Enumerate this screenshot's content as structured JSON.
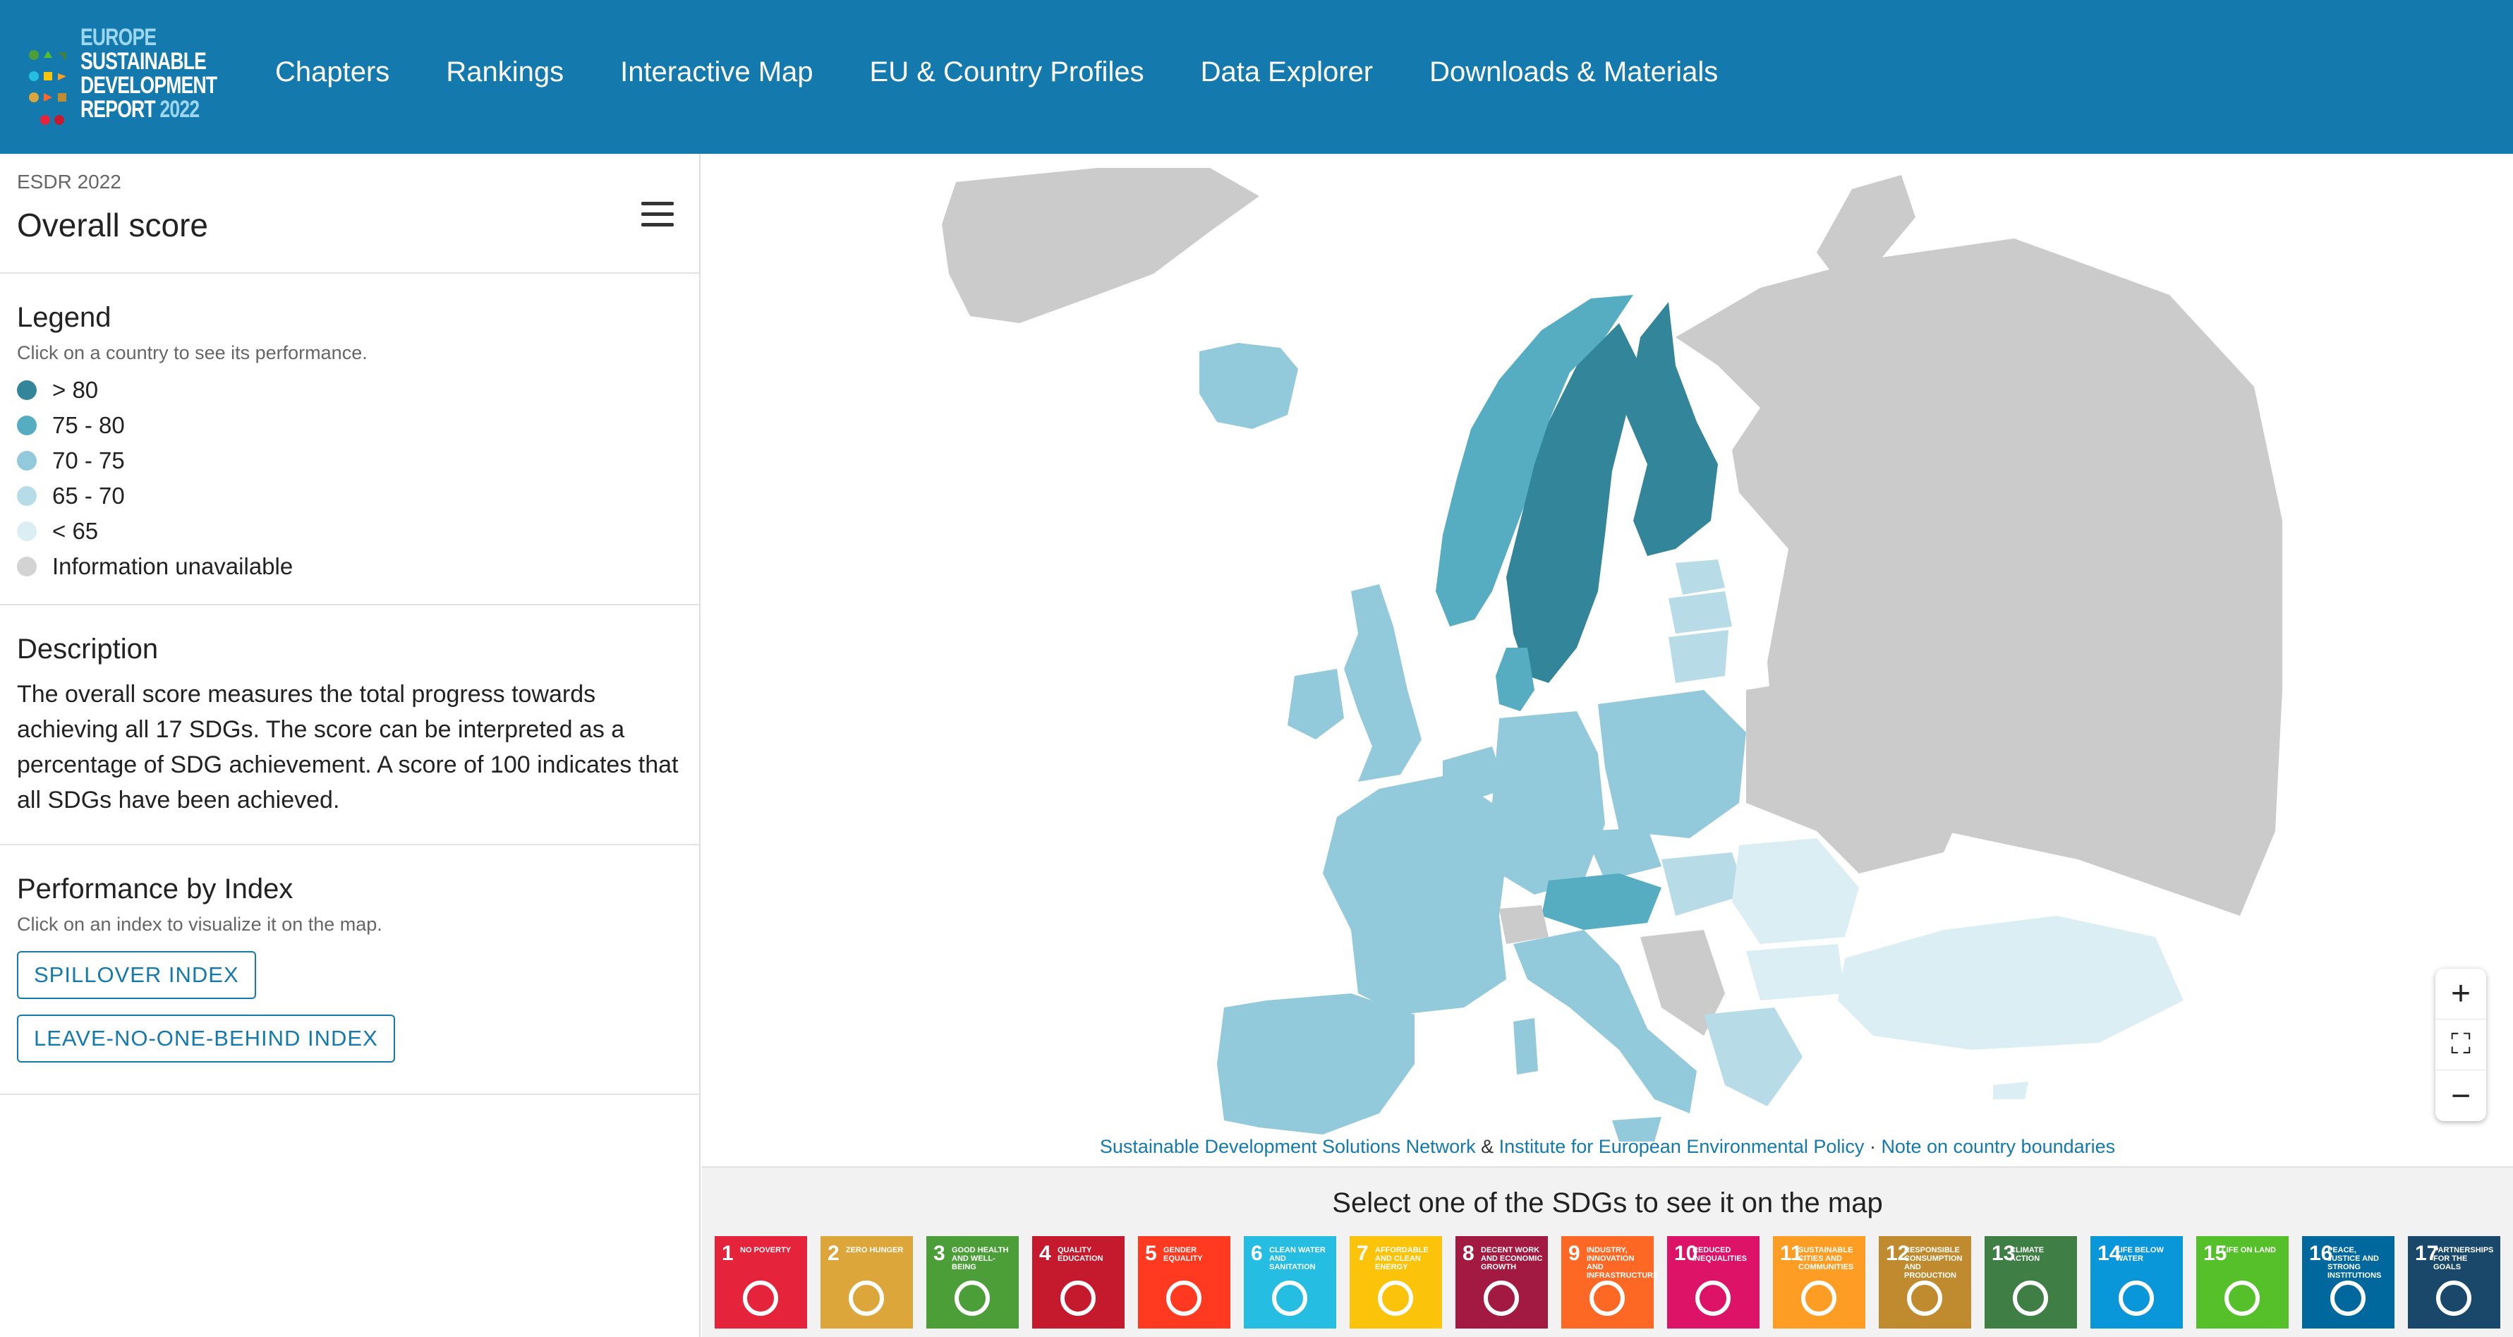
{
  "logo": {
    "line1": "Europe",
    "line2": "Sustainable",
    "line3": "Development",
    "line4": "Report",
    "year": "2022"
  },
  "nav": [
    "Chapters",
    "Rankings",
    "Interactive Map",
    "EU & Country Profiles",
    "Data Explorer",
    "Downloads & Materials"
  ],
  "sidebar": {
    "eyebrow": "ESDR 2022",
    "title": "Overall score",
    "legend": {
      "heading": "Legend",
      "hint": "Click on a country to see its performance.",
      "items": [
        {
          "label": "> 80",
          "color": "#33869a"
        },
        {
          "label": "75 - 80",
          "color": "#56adc2"
        },
        {
          "label": "70 - 75",
          "color": "#93cadb"
        },
        {
          "label": "65 - 70",
          "color": "#b8dce7"
        },
        {
          "label": "< 65",
          "color": "#dbeef4"
        },
        {
          "label": "Information unavailable",
          "color": "#d3d3d3"
        }
      ]
    },
    "description": {
      "heading": "Description",
      "text": "The overall score measures the total progress towards achieving all 17 SDGs. The score can be interpreted as a percentage of SDG achievement. A score of 100 indicates that all SDGs have been achieved."
    },
    "performance": {
      "heading": "Performance by Index",
      "hint": "Click on an index to visualize it on the map.",
      "buttons": [
        "SPILLOVER INDEX",
        "LEAVE-NO-ONE-BEHIND INDEX"
      ]
    }
  },
  "attribution": {
    "link1": "Sustainable Development Solutions Network",
    "sep1": " & ",
    "link2": "Institute for European Environmental Policy",
    "sep2": " · ",
    "link3": "Note on country boundaries"
  },
  "zoom": {
    "in": "+",
    "fullscreen": "⛶",
    "out": "−"
  },
  "sdg_bar": {
    "title": "Select one of the SDGs to see it on the map",
    "goals": [
      {
        "num": "1",
        "label": "No poverty",
        "color": "#e5243b"
      },
      {
        "num": "2",
        "label": "Zero hunger",
        "color": "#dda63a"
      },
      {
        "num": "3",
        "label": "Good health and well-being",
        "color": "#4c9f38"
      },
      {
        "num": "4",
        "label": "Quality education",
        "color": "#c5192d"
      },
      {
        "num": "5",
        "label": "Gender equality",
        "color": "#ff3a21"
      },
      {
        "num": "6",
        "label": "Clean water and sanitation",
        "color": "#26bde2"
      },
      {
        "num": "7",
        "label": "Affordable and clean energy",
        "color": "#fcc30b"
      },
      {
        "num": "8",
        "label": "Decent work and economic growth",
        "color": "#a21942"
      },
      {
        "num": "9",
        "label": "Industry, innovation and infrastructure",
        "color": "#fd6925"
      },
      {
        "num": "10",
        "label": "Reduced inequalities",
        "color": "#dd1367"
      },
      {
        "num": "11",
        "label": "Sustainable cities and communities",
        "color": "#fd9d24"
      },
      {
        "num": "12",
        "label": "Responsible consumption and production",
        "color": "#bf8b2e"
      },
      {
        "num": "13",
        "label": "Climate action",
        "color": "#3f7e44"
      },
      {
        "num": "14",
        "label": "Life below water",
        "color": "#0a97d9"
      },
      {
        "num": "15",
        "label": "Life on land",
        "color": "#56c02b"
      },
      {
        "num": "16",
        "label": "Peace, justice and strong institutions",
        "color": "#00689d"
      },
      {
        "num": "17",
        "label": "Partnerships for the goals",
        "color": "#19486a"
      }
    ]
  }
}
